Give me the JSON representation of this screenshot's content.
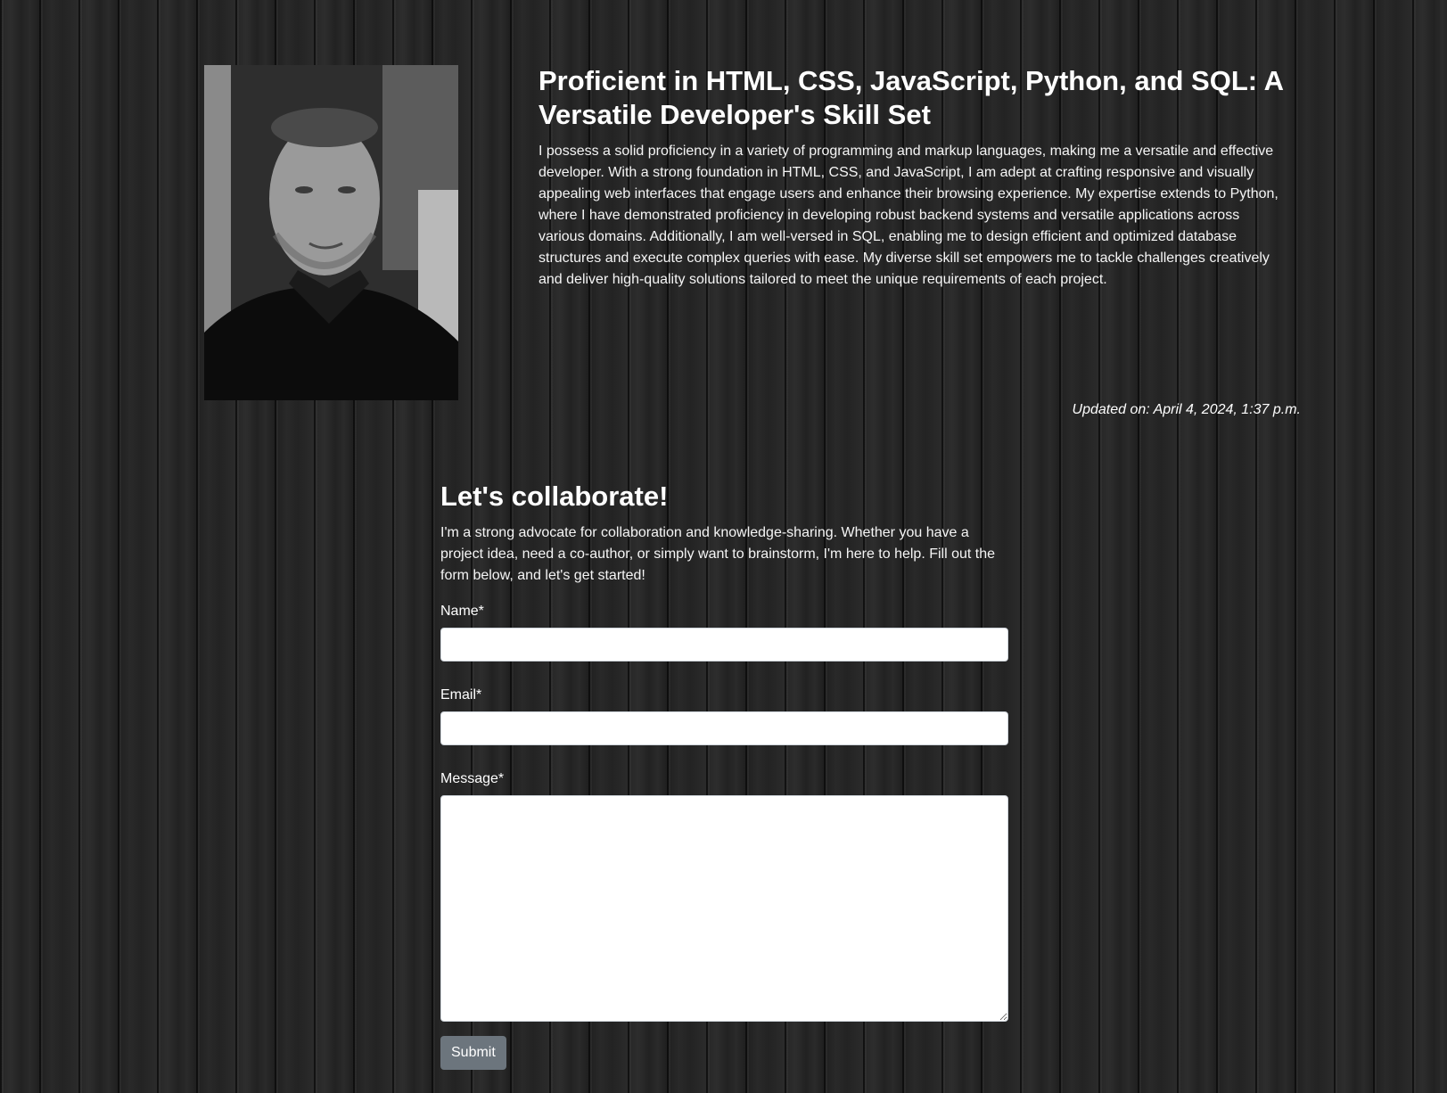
{
  "skills": {
    "title": "Proficient in HTML, CSS, JavaScript, Python, and SQL: A Versatile Developer's Skill Set",
    "body": "I possess a solid proficiency in a variety of programming and markup languages, making me a versatile and effective developer. With a strong foundation in HTML, CSS, and JavaScript, I am adept at crafting responsive and visually appealing web interfaces that engage users and enhance their browsing experience. My expertise extends to Python, where I have demonstrated proficiency in developing robust backend systems and versatile applications across various domains. Additionally, I am well-versed in SQL, enabling me to design efficient and optimized database structures and execute complex queries with ease. My diverse skill set empowers me to tackle challenges creatively and deliver high-quality solutions tailored to meet the unique requirements of each project.",
    "updated": "Updated on: April 4, 2024, 1:37 p.m."
  },
  "collaborate": {
    "title": "Let's collaborate!",
    "intro": "I'm a strong advocate for collaboration and knowledge-sharing. Whether you have a project idea, need a co-author, or simply want to brainstorm, I'm here to help. Fill out the form below, and let's get started!",
    "form": {
      "name_label": "Name*",
      "name_value": "",
      "email_label": "Email*",
      "email_value": "",
      "message_label": "Message*",
      "message_value": "",
      "submit_label": "Submit"
    }
  },
  "colors": {
    "background": "#242424",
    "submit_button": "#6c757d",
    "text": "#ffffff"
  }
}
